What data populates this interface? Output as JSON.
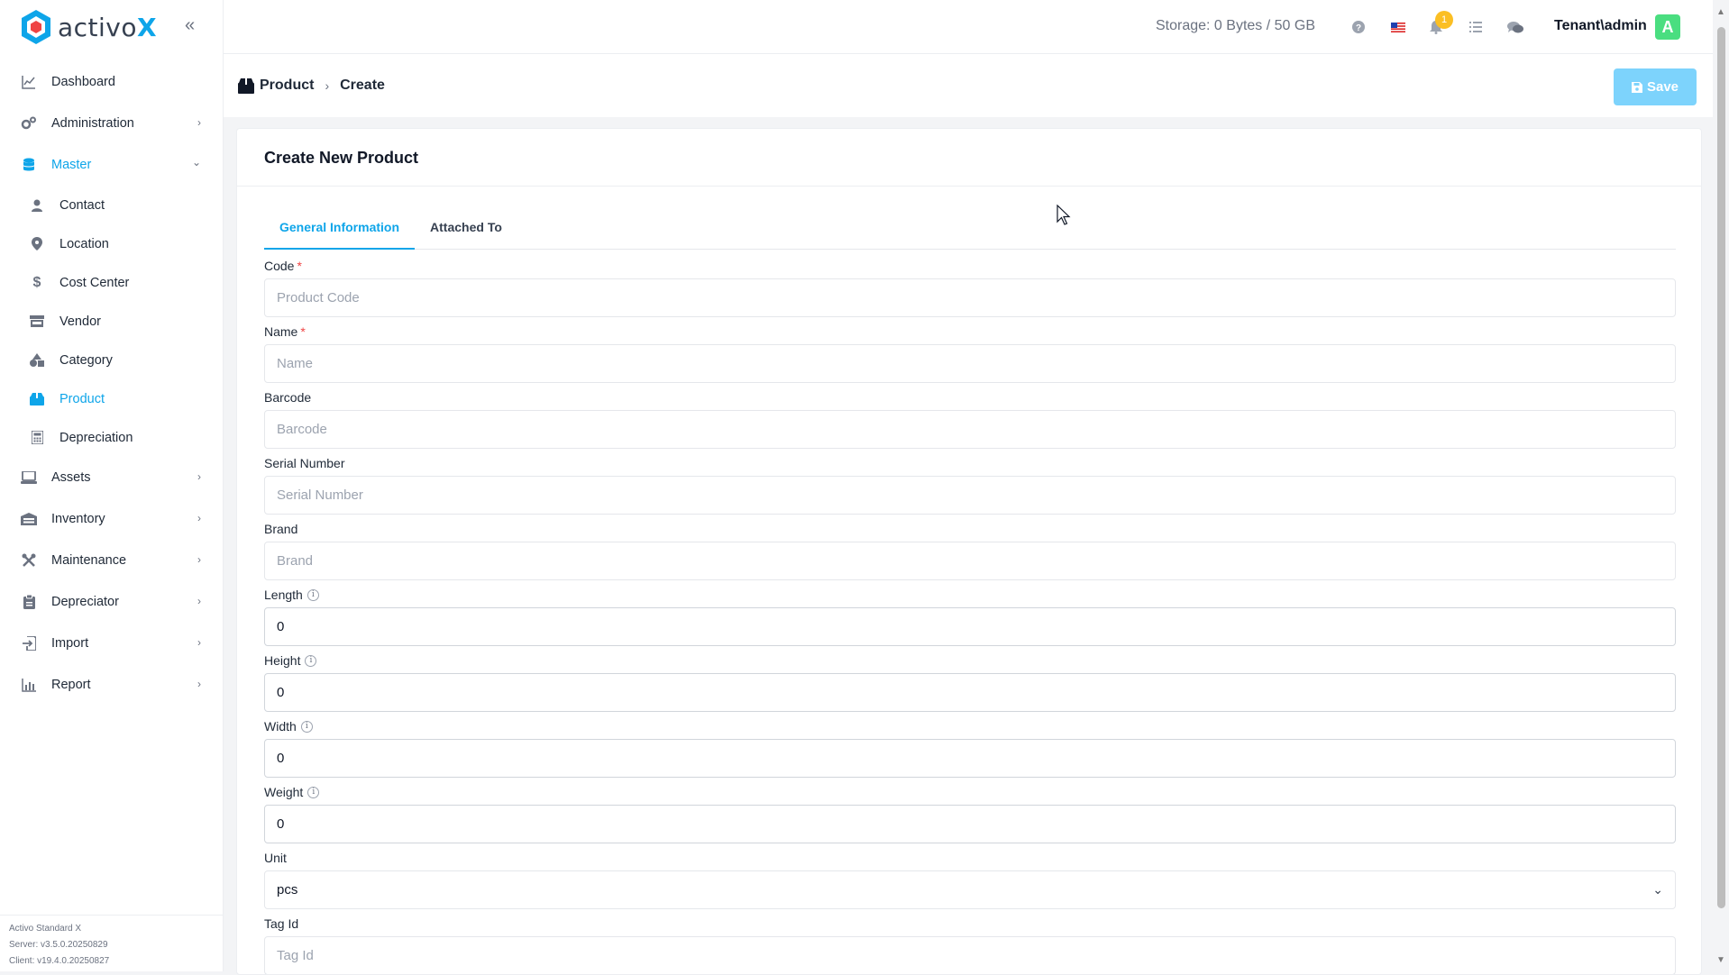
{
  "app": {
    "logo_text": "activo",
    "logo_x": "X"
  },
  "sidebar": {
    "items": [
      {
        "label": "Dashboard",
        "icon": "chart-line-icon",
        "has_chevron": false
      },
      {
        "label": "Administration",
        "icon": "gears-icon",
        "has_chevron": true
      },
      {
        "label": "Master",
        "icon": "database-icon",
        "has_chevron": true,
        "expanded": true
      }
    ],
    "sub_items": [
      {
        "label": "Contact",
        "icon": "user-icon"
      },
      {
        "label": "Location",
        "icon": "map-pin-icon"
      },
      {
        "label": "Cost Center",
        "icon": "dollar-icon"
      },
      {
        "label": "Vendor",
        "icon": "store-icon"
      },
      {
        "label": "Category",
        "icon": "shapes-icon"
      },
      {
        "label": "Product",
        "icon": "box-icon",
        "active": true
      },
      {
        "label": "Depreciation",
        "icon": "calculator-icon"
      }
    ],
    "items_after": [
      {
        "label": "Assets",
        "icon": "laptop-icon"
      },
      {
        "label": "Inventory",
        "icon": "warehouse-icon"
      },
      {
        "label": "Maintenance",
        "icon": "tools-icon"
      },
      {
        "label": "Depreciator",
        "icon": "clipboard-icon"
      },
      {
        "label": "Import",
        "icon": "import-icon"
      },
      {
        "label": "Report",
        "icon": "bar-chart-icon"
      }
    ],
    "footer": {
      "product": "Activo Standard X",
      "server": "Server: v3.5.0.20250829",
      "client": "Client: v19.4.0.20250827"
    }
  },
  "topbar": {
    "storage": "Storage: 0 Bytes / 50 GB",
    "notification_count": "1",
    "user": "Tenant\\admin",
    "avatar_letter": "A"
  },
  "breadcrumb": {
    "parent": "Product",
    "current": "Create"
  },
  "toolbar": {
    "save_label": "Save"
  },
  "card": {
    "title": "Create New Product",
    "tabs": [
      "General Information",
      "Attached To"
    ],
    "active_tab": 0
  },
  "form": {
    "code": {
      "label": "Code",
      "placeholder": "Product Code",
      "value": ""
    },
    "name": {
      "label": "Name",
      "placeholder": "Name",
      "value": ""
    },
    "barcode": {
      "label": "Barcode",
      "placeholder": "Barcode",
      "value": ""
    },
    "serial": {
      "label": "Serial Number",
      "placeholder": "Serial Number",
      "value": ""
    },
    "brand": {
      "label": "Brand",
      "placeholder": "Brand",
      "value": ""
    },
    "length": {
      "label": "Length",
      "value": "0"
    },
    "height": {
      "label": "Height",
      "value": "0"
    },
    "width": {
      "label": "Width",
      "value": "0"
    },
    "weight": {
      "label": "Weight",
      "value": "0"
    },
    "unit": {
      "label": "Unit",
      "value": "pcs"
    },
    "tag_id": {
      "label": "Tag Id",
      "placeholder": "Tag Id",
      "value": ""
    }
  },
  "colors": {
    "accent": "#0ea5e9",
    "save_button": "#7dd3fc",
    "avatar": "#4ade80",
    "badge": "#fbbf24"
  }
}
